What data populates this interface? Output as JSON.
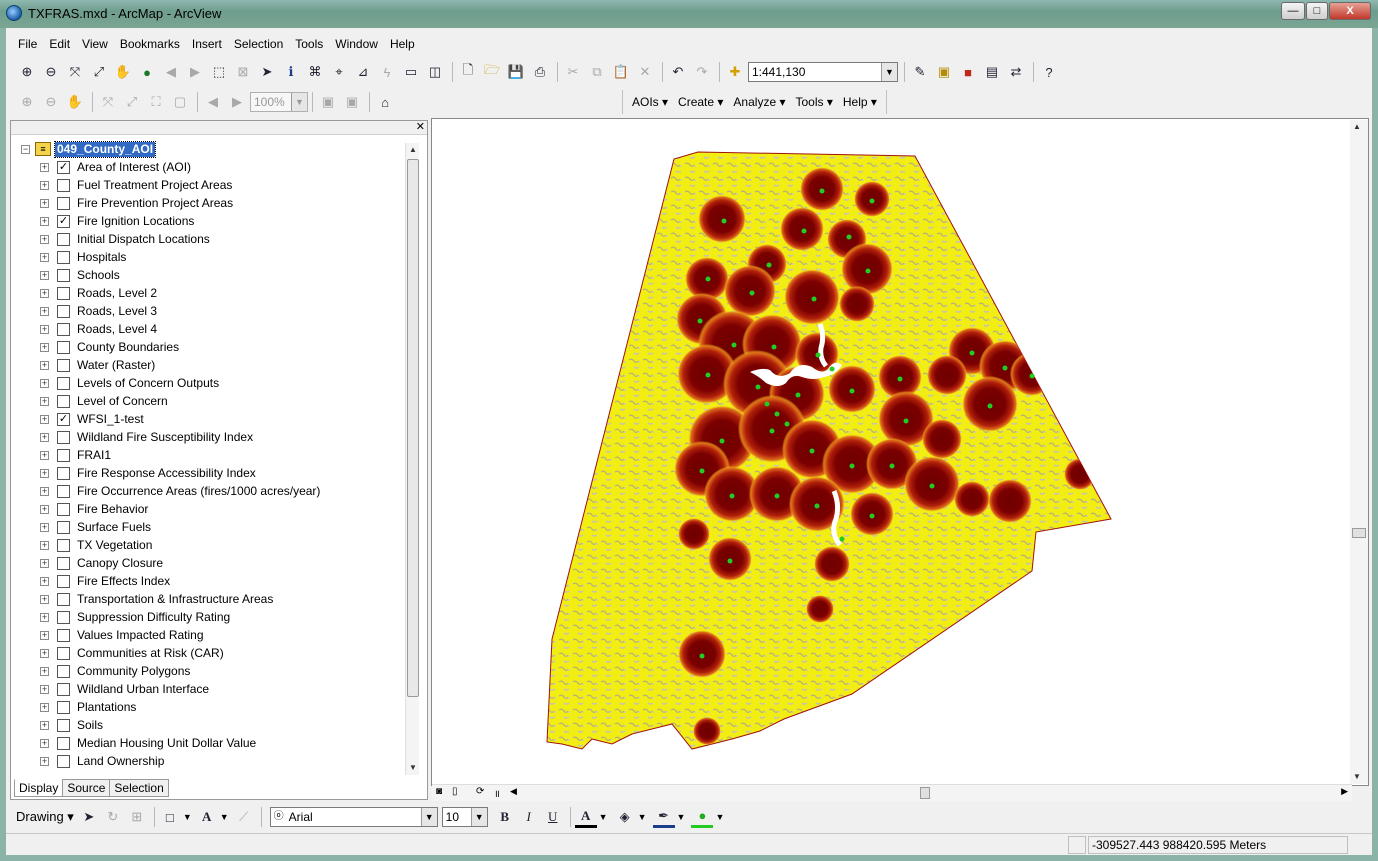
{
  "window": {
    "title": "TXFRAS.mxd - ArcMap - ArcView",
    "min_label": "—",
    "max_label": "□",
    "close_label": "X"
  },
  "menubar": {
    "items": [
      "File",
      "Edit",
      "View",
      "Bookmarks",
      "Insert",
      "Selection",
      "Tools",
      "Window",
      "Help"
    ]
  },
  "standard_toolbar": {
    "scale": "1:441,130"
  },
  "layout_toolbar": {
    "zoom_percent": "100%"
  },
  "aoi_toolbar": {
    "menus": [
      "AOIs",
      "Create",
      "Analyze",
      "Tools",
      "Help"
    ]
  },
  "toc": {
    "group_name": "049_County_AOI",
    "layers": [
      {
        "name": "Area of Interest (AOI)",
        "checked": true
      },
      {
        "name": "Fuel Treatment Project Areas",
        "checked": false
      },
      {
        "name": "Fire Prevention Project Areas",
        "checked": false
      },
      {
        "name": "Fire Ignition Locations",
        "checked": true
      },
      {
        "name": "Initial Dispatch Locations",
        "checked": false
      },
      {
        "name": "Hospitals",
        "checked": false
      },
      {
        "name": "Schools",
        "checked": false
      },
      {
        "name": "Roads, Level 2",
        "checked": false
      },
      {
        "name": "Roads, Level 3",
        "checked": false
      },
      {
        "name": "Roads, Level 4",
        "checked": false
      },
      {
        "name": "County Boundaries",
        "checked": false
      },
      {
        "name": "Water (Raster)",
        "checked": false
      },
      {
        "name": "Levels of Concern Outputs",
        "checked": false
      },
      {
        "name": "Level of Concern",
        "checked": false
      },
      {
        "name": "WFSI_1-test",
        "checked": true
      },
      {
        "name": "Wildland Fire Susceptibility Index",
        "checked": false
      },
      {
        "name": "FRAI1",
        "checked": false
      },
      {
        "name": "Fire Response Accessibility Index",
        "checked": false
      },
      {
        "name": "Fire Occurrence Areas (fires/1000 acres/year)",
        "checked": false
      },
      {
        "name": "Fire Behavior",
        "checked": false
      },
      {
        "name": "Surface Fuels",
        "checked": false
      },
      {
        "name": "TX Vegetation",
        "checked": false
      },
      {
        "name": "Canopy Closure",
        "checked": false
      },
      {
        "name": "Fire Effects Index",
        "checked": false
      },
      {
        "name": "Transportation & Infrastructure Areas",
        "checked": false
      },
      {
        "name": "Suppression Difficulty Rating",
        "checked": false
      },
      {
        "name": "Values Impacted Rating",
        "checked": false
      },
      {
        "name": "Communities at Risk (CAR)",
        "checked": false
      },
      {
        "name": "Community Polygons",
        "checked": false
      },
      {
        "name": "Wildland Urban Interface",
        "checked": false
      },
      {
        "name": "Plantations",
        "checked": false
      },
      {
        "name": "Soils",
        "checked": false
      },
      {
        "name": "Median Housing Unit Dollar Value",
        "checked": false
      },
      {
        "name": "Land Ownership",
        "checked": false
      }
    ],
    "tabs": [
      "Display",
      "Source",
      "Selection"
    ]
  },
  "drawing_toolbar": {
    "drawing_label": "Drawing",
    "font": "Arial",
    "font_size": "10",
    "bold": "B",
    "italic": "I",
    "underline": "U",
    "font_color_glyph": "A"
  },
  "status": {
    "coordinates": "-309527.443  988420.595 Meters"
  },
  "colors": {
    "county_fill": "#f2ee14",
    "hotspot_dark": "#7a0000",
    "hotspot_mid": "#b0200a",
    "hotspot_edge": "#e0701a",
    "ignition_points": "#22cc22",
    "water": "#ffffff",
    "gray_patches": "#c9c5a8",
    "selection": "#316ac5"
  }
}
